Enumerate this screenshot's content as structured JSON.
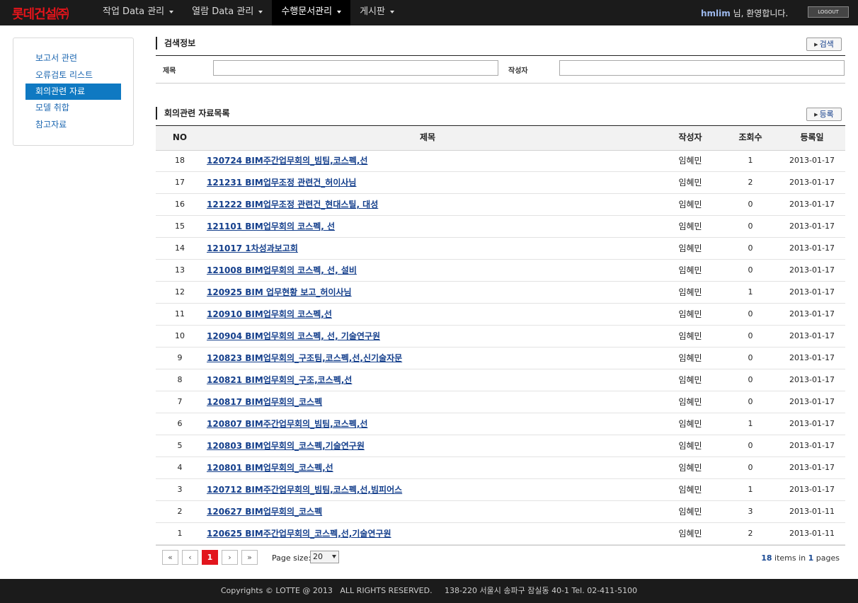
{
  "brand": "롯데건설㈜",
  "nav": {
    "items": [
      {
        "label": "작업 Data 관리",
        "active": false
      },
      {
        "label": "열람 Data 관리",
        "active": false
      },
      {
        "label": "수행문서관리",
        "active": true
      },
      {
        "label": "게시판",
        "active": false
      }
    ],
    "welcome_user": "hmlim",
    "welcome_suffix": " 님, 환영합니다.",
    "logout_label": "LOGOUT"
  },
  "sidebar": {
    "items": [
      {
        "label": "보고서 관련",
        "active": false
      },
      {
        "label": "오류검토 리스트",
        "active": false
      },
      {
        "label": "회의관련 자료",
        "active": true
      },
      {
        "label": "모델 취합",
        "active": false
      },
      {
        "label": "참고자료",
        "active": false
      }
    ]
  },
  "search": {
    "title": "검색정보",
    "button": "검색",
    "title_label": "제목",
    "title_value": "",
    "author_label": "작성자",
    "author_value": ""
  },
  "list": {
    "title": "회의관련 자료목록",
    "register_button": "등록",
    "columns": {
      "no": "NO",
      "title": "제목",
      "author": "작성자",
      "views": "조회수",
      "date": "등록일"
    },
    "rows": [
      {
        "no": "18",
        "title": "120724 BIM주간업무회의_빔팀,코스펙,선",
        "author": "임혜민",
        "views": "1",
        "date": "2013-01-17"
      },
      {
        "no": "17",
        "title": "121231 BIM업무조정 관련건_허이사님",
        "author": "임혜민",
        "views": "2",
        "date": "2013-01-17"
      },
      {
        "no": "16",
        "title": "121222 BIM업무조정 관련건_현대스틸, 대성",
        "author": "임혜민",
        "views": "0",
        "date": "2013-01-17"
      },
      {
        "no": "15",
        "title": "121101 BIM업무회의 코스펙, 선",
        "author": "임혜민",
        "views": "0",
        "date": "2013-01-17"
      },
      {
        "no": "14",
        "title": "121017 1차성과보고회",
        "author": "임혜민",
        "views": "0",
        "date": "2013-01-17"
      },
      {
        "no": "13",
        "title": "121008 BIM업무회의 코스펙, 선, 설비",
        "author": "임혜민",
        "views": "0",
        "date": "2013-01-17"
      },
      {
        "no": "12",
        "title": "120925 BIM 업무현황 보고_허이사님",
        "author": "임혜민",
        "views": "1",
        "date": "2013-01-17"
      },
      {
        "no": "11",
        "title": "120910 BIM업무회의 코스펙,선",
        "author": "임혜민",
        "views": "0",
        "date": "2013-01-17"
      },
      {
        "no": "10",
        "title": "120904 BIM업무회의 코스펙, 선, 기술연구원",
        "author": "임혜민",
        "views": "0",
        "date": "2013-01-17"
      },
      {
        "no": "9",
        "title": "120823 BIM업무회의_구조팀,코스펙,선,신기술자문",
        "author": "임혜민",
        "views": "0",
        "date": "2013-01-17"
      },
      {
        "no": "8",
        "title": "120821 BIM업무회의_구조,코스펙,선",
        "author": "임혜민",
        "views": "0",
        "date": "2013-01-17"
      },
      {
        "no": "7",
        "title": "120817 BIM업무회의_코스펙",
        "author": "임혜민",
        "views": "0",
        "date": "2013-01-17"
      },
      {
        "no": "6",
        "title": "120807 BIM주간업무회의_빔팀,코스펙,선",
        "author": "임혜민",
        "views": "1",
        "date": "2013-01-17"
      },
      {
        "no": "5",
        "title": "120803 BIM업무회의_코스펙,기술연구원",
        "author": "임혜민",
        "views": "0",
        "date": "2013-01-17"
      },
      {
        "no": "4",
        "title": "120801 BIM업무회의_코스펙,선",
        "author": "임혜민",
        "views": "0",
        "date": "2013-01-17"
      },
      {
        "no": "3",
        "title": "120712 BIM주간업무회의_빔팀,코스펙,선,빔피어스",
        "author": "임혜민",
        "views": "1",
        "date": "2013-01-17"
      },
      {
        "no": "2",
        "title": "120627 BIM업무회의_코스펙",
        "author": "임혜민",
        "views": "3",
        "date": "2013-01-11"
      },
      {
        "no": "1",
        "title": "120625 BIM주간업무회의_코스펙,선,기술연구원",
        "author": "임혜민",
        "views": "2",
        "date": "2013-01-11"
      }
    ]
  },
  "pager": {
    "first": "«",
    "prev": "‹",
    "current": "1",
    "next": "›",
    "last": "»",
    "page_size_label": "Page size:",
    "page_size": "20",
    "total_items": "18",
    "items_in": " items in ",
    "total_pages": "1",
    "pages_word": " pages"
  },
  "footer": "Copyrights © LOTTE @ 2013   ALL RIGHTS RESERVED.     138-220 서울시 송파구 잠실동 40-1 Tel. 02-411-5100"
}
